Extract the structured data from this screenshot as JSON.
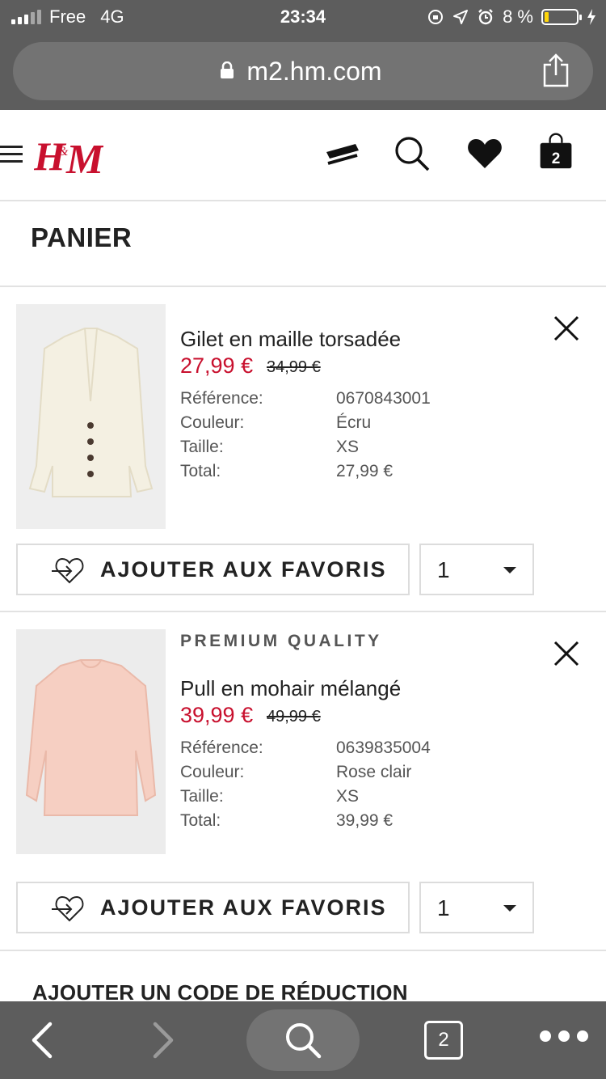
{
  "status_bar": {
    "carrier": "Free",
    "network": "4G",
    "time": "23:34",
    "battery": "8 %",
    "battery_level": 0.08
  },
  "browser": {
    "url": "m2.hm.com"
  },
  "header": {
    "logo": "H&M",
    "bag_count": "2"
  },
  "page": {
    "title": "PANIER"
  },
  "products": [
    {
      "brand_tag": "",
      "name": "Gilet en maille torsadée",
      "price": "27,99 €",
      "old_price": "34,99 €",
      "ref_label": "Référence:",
      "ref_value": "0670843001",
      "color_label": "Couleur:",
      "color_value": "Écru",
      "size_label": "Taille:",
      "size_value": "XS",
      "total_label": "Total:",
      "total_value": "27,99 €",
      "fav_label": "AJOUTER AUX FAVORIS",
      "qty": "1"
    },
    {
      "brand_tag": "PREMIUM QUALITY",
      "name": "Pull en mohair mélangé",
      "price": "39,99 €",
      "old_price": "49,99 €",
      "ref_label": "Référence:",
      "ref_value": "0639835004",
      "color_label": "Couleur:",
      "color_value": "Rose clair",
      "size_label": "Taille:",
      "size_value": "XS",
      "total_label": "Total:",
      "total_value": "39,99 €",
      "fav_label": "AJOUTER AUX FAVORIS",
      "qty": "1"
    }
  ],
  "discount": {
    "label": "AJOUTER UN CODE DE RÉDUCTION"
  },
  "toolbar": {
    "tabs_count": "2"
  },
  "colors": {
    "brand_red": "#c8102e",
    "sale_red": "#c8102e",
    "chrome_gray": "#5d5d5d"
  }
}
